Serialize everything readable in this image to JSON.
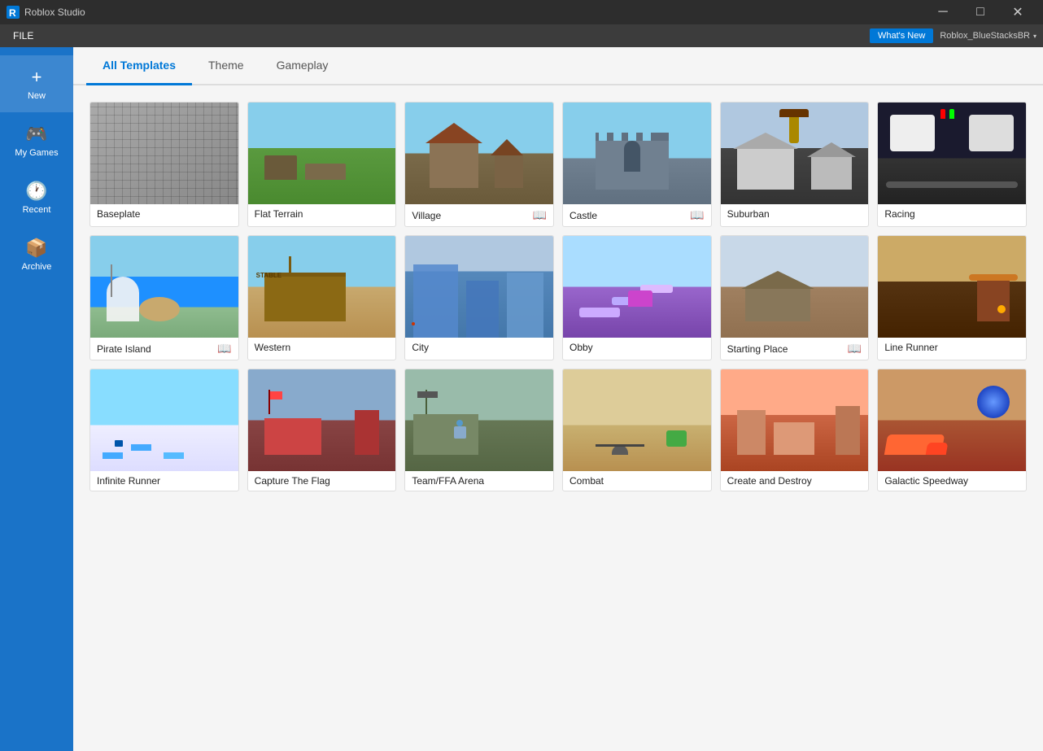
{
  "titlebar": {
    "app_name": "Roblox Studio",
    "controls": [
      "─",
      "□",
      "✕"
    ]
  },
  "menubar": {
    "file_label": "FILE",
    "whats_new": "What's New",
    "user": "Roblox_BlueStacksBR",
    "dropdown_arrow": "▾"
  },
  "sidebar": {
    "items": [
      {
        "id": "new",
        "label": "New",
        "icon": "+"
      },
      {
        "id": "my-games",
        "label": "My Games",
        "icon": "🎮"
      },
      {
        "id": "recent",
        "label": "Recent",
        "icon": "🕐"
      },
      {
        "id": "archive",
        "label": "Archive",
        "icon": "📦"
      }
    ]
  },
  "tabs": [
    {
      "id": "all-templates",
      "label": "All Templates",
      "active": true
    },
    {
      "id": "theme",
      "label": "Theme",
      "active": false
    },
    {
      "id": "gameplay",
      "label": "Gameplay",
      "active": false
    }
  ],
  "templates": [
    {
      "id": "baseplate",
      "name": "Baseplate",
      "has_book": false,
      "bg": "baseplate-grid"
    },
    {
      "id": "flat-terrain",
      "name": "Flat Terrain",
      "has_book": false,
      "bg": "bg-flat"
    },
    {
      "id": "village",
      "name": "Village",
      "has_book": true,
      "bg": "bg-village"
    },
    {
      "id": "castle",
      "name": "Castle",
      "has_book": true,
      "bg": "bg-castle"
    },
    {
      "id": "suburban",
      "name": "Suburban",
      "has_book": false,
      "bg": "bg-suburban"
    },
    {
      "id": "racing",
      "name": "Racing",
      "has_book": false,
      "bg": "bg-racing"
    },
    {
      "id": "pirate-island",
      "name": "Pirate Island",
      "has_book": true,
      "bg": "bg-pirate"
    },
    {
      "id": "western",
      "name": "Western",
      "has_book": false,
      "bg": "bg-western"
    },
    {
      "id": "city",
      "name": "City",
      "has_book": false,
      "bg": "bg-city"
    },
    {
      "id": "obby",
      "name": "Obby",
      "has_book": false,
      "bg": "bg-obby"
    },
    {
      "id": "starting-place",
      "name": "Starting Place",
      "has_book": true,
      "bg": "bg-starting"
    },
    {
      "id": "line-runner",
      "name": "Line Runner",
      "has_book": false,
      "bg": "bg-linerunner"
    },
    {
      "id": "infinite-runner",
      "name": "Infinite Runner",
      "has_book": false,
      "bg": "bg-infinite"
    },
    {
      "id": "capture-the-flag",
      "name": "Capture The Flag",
      "has_book": false,
      "bg": "bg-ctf"
    },
    {
      "id": "team-ffa-arena",
      "name": "Team/FFA Arena",
      "has_book": false,
      "bg": "bg-teamffa"
    },
    {
      "id": "combat",
      "name": "Combat",
      "has_book": false,
      "bg": "bg-combat"
    },
    {
      "id": "create-and-destroy",
      "name": "Create and Destroy",
      "has_book": false,
      "bg": "bg-createdes"
    },
    {
      "id": "galactic-speedway",
      "name": "Galactic Speedway",
      "has_book": false,
      "bg": "bg-galactic"
    }
  ],
  "book_icon": "📖",
  "roblox_logo_text": "R"
}
